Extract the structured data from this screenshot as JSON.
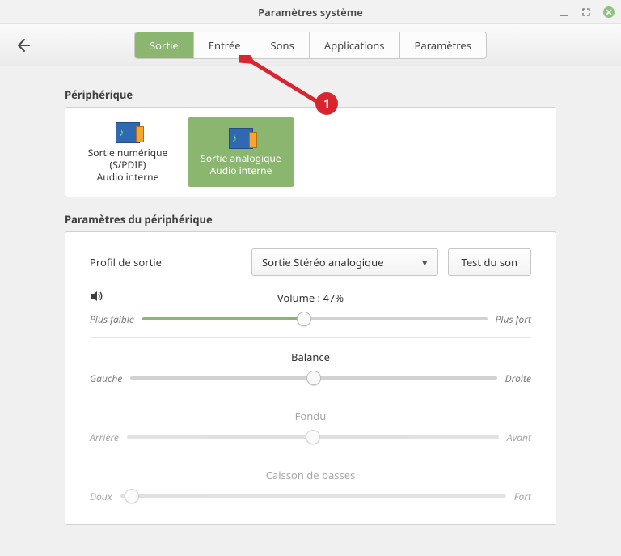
{
  "window": {
    "title": "Paramètres système"
  },
  "tabs": [
    "Sortie",
    "Entrée",
    "Sons",
    "Applications",
    "Paramètres"
  ],
  "active_tab_index": 0,
  "section_device_label": "Périphérique",
  "devices": [
    {
      "line1": "Sortie numérique (S/PDIF)",
      "line2": "Audio interne",
      "selected": false
    },
    {
      "line1": "Sortie analogique",
      "line2": "Audio interne",
      "selected": true
    }
  ],
  "section_settings_label": "Paramètres du périphérique",
  "profile": {
    "label": "Profil de sortie",
    "selected": "Sortie Stéréo analogique",
    "test_button": "Test du son"
  },
  "sliders": {
    "volume": {
      "title": "Volume : 47%",
      "left": "Plus faible",
      "right": "Plus fort",
      "percent": 47,
      "enabled": true,
      "fill": true
    },
    "balance": {
      "title": "Balance",
      "left": "Gauche",
      "right": "Droite",
      "percent": 50,
      "enabled": true,
      "fill": false
    },
    "fade": {
      "title": "Fondu",
      "left": "Arrière",
      "right": "Avant",
      "percent": 50,
      "enabled": false,
      "fill": false
    },
    "sub": {
      "title": "Caisson de basses",
      "left": "Doux",
      "right": "Fort",
      "percent": 3,
      "enabled": false,
      "fill": false
    }
  },
  "annotation": {
    "number": "1"
  }
}
